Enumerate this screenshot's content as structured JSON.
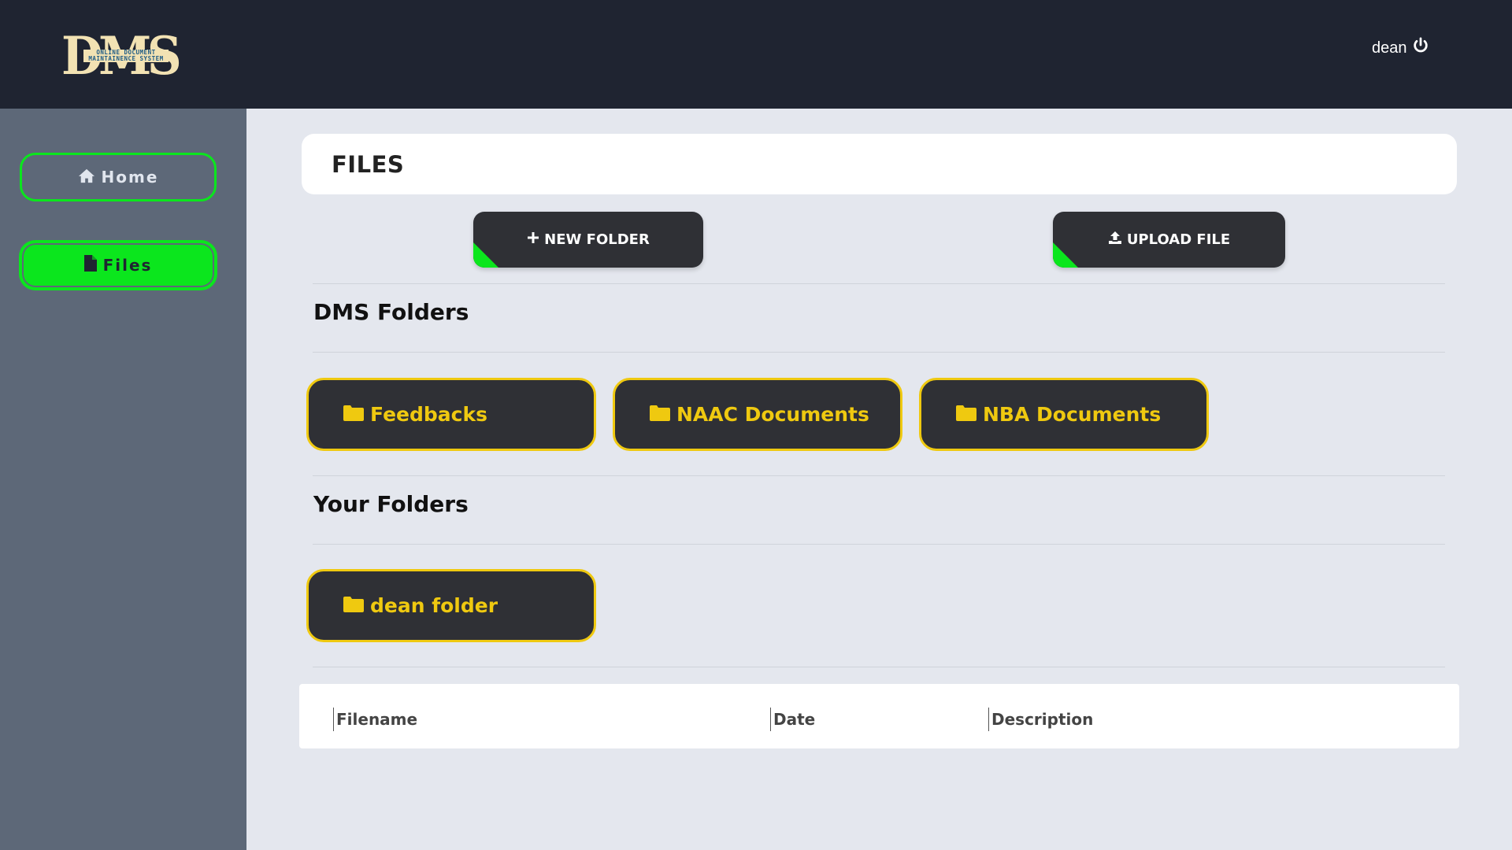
{
  "header": {
    "logo_text": "DMS",
    "logo_subtitle_line1": "ONLINE DOCUMENT",
    "logo_subtitle_line2": "MAINTAINENCE SYSTEM",
    "username": "dean",
    "logout_icon": "power-icon"
  },
  "sidebar": {
    "items": [
      {
        "label": "Home",
        "icon": "home-icon",
        "active": false
      },
      {
        "label": "Files",
        "icon": "file-icon",
        "active": true
      }
    ]
  },
  "page": {
    "title": "FILES"
  },
  "actions": {
    "new_folder_label": "NEW FOLDER",
    "upload_file_label": "UPLOAD FILE"
  },
  "dms_folders": {
    "title": "DMS Folders",
    "items": [
      "Feedbacks",
      "NAAC Documents",
      "NBA Documents"
    ]
  },
  "your_folders": {
    "title": "Your Folders",
    "items": [
      "dean folder"
    ]
  },
  "files_table": {
    "columns": [
      "Filename",
      "Date",
      "Description"
    ]
  },
  "colors": {
    "topbar": "#1f2431",
    "sidebar": "#5d6878",
    "accent_green": "#0be61d",
    "folder_gold": "#efc910",
    "button_dark": "#2f3035",
    "content_bg": "#e4e7ee"
  }
}
